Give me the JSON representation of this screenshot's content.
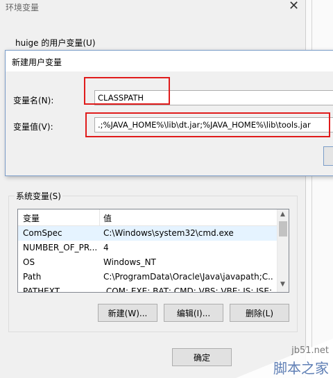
{
  "env_window": {
    "title": "环境变量",
    "close_glyph": "✕",
    "user_group_label": "huige 的用户变量(U)"
  },
  "dialog": {
    "title": "新建用户变量",
    "name_label": "变量名(N):",
    "value_label": "变量值(V):",
    "name_value": "CLASSPATH",
    "value_value": ".;%JAVA_HOME%\\lib\\dt.jar;%JAVA_HOME%\\lib\\tools.jar",
    "highlight_color": "#e01b1b"
  },
  "system_vars": {
    "group_label": "系统变量(S)",
    "columns": [
      "变量",
      "值"
    ],
    "rows": [
      {
        "name": "ComSpec",
        "value": "C:\\Windows\\system32\\cmd.exe"
      },
      {
        "name": "NUMBER_OF_PR...",
        "value": "4"
      },
      {
        "name": "OS",
        "value": "Windows_NT"
      },
      {
        "name": "Path",
        "value": "C:\\ProgramData\\Oracle\\Java\\javapath;C..."
      },
      {
        "name": "PATHEXT",
        "value": ".COM;.EXE;.BAT;.CMD;.VBS;.VBE;.JS;.JSE;..."
      }
    ],
    "buttons": {
      "new": "新建(W)...",
      "edit": "编辑(I)...",
      "delete": "删除(L)"
    }
  },
  "footer": {
    "ok": "确定"
  },
  "watermark": {
    "site": "jb51.net",
    "name": "脚本之家"
  }
}
